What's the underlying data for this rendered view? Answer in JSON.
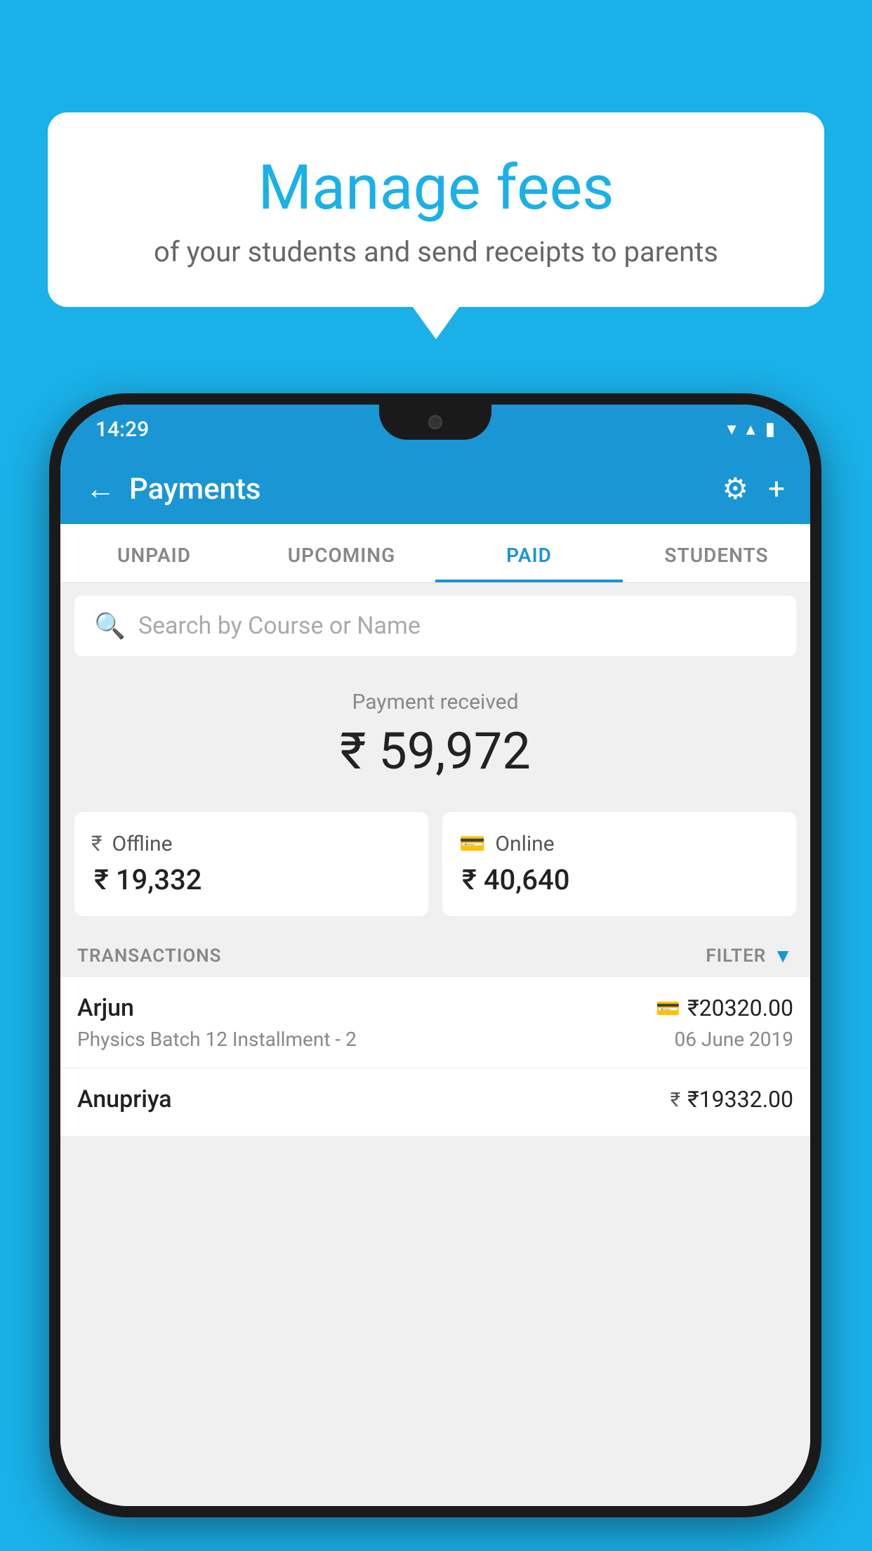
{
  "page": {
    "bg_color": "#1ab0e8"
  },
  "speech_bubble": {
    "title": "Manage fees",
    "subtitle": "of your students and send receipts to parents"
  },
  "status_bar": {
    "time": "14:29",
    "wifi_icon": "▼",
    "signal_icon": "▲",
    "battery_icon": "▮"
  },
  "app_bar": {
    "title": "Payments",
    "back_label": "←",
    "settings_label": "⚙",
    "add_label": "+"
  },
  "tabs": [
    {
      "label": "UNPAID",
      "active": false
    },
    {
      "label": "UPCOMING",
      "active": false
    },
    {
      "label": "PAID",
      "active": true
    },
    {
      "label": "STUDENTS",
      "active": false
    }
  ],
  "search": {
    "placeholder": "Search by Course or Name"
  },
  "payment_summary": {
    "label": "Payment received",
    "total": "₹ 59,972",
    "offline_label": "Offline",
    "offline_amount": "₹ 19,332",
    "online_label": "Online",
    "online_amount": "₹ 40,640"
  },
  "transactions_section": {
    "label": "TRANSACTIONS",
    "filter_label": "FILTER"
  },
  "transactions": [
    {
      "name": "Arjun",
      "course": "Physics Batch 12 Installment - 2",
      "amount": "₹20320.00",
      "date": "06 June 2019",
      "payment_type": "card"
    },
    {
      "name": "Anupriya",
      "course": "",
      "amount": "₹19332.00",
      "date": "",
      "payment_type": "cash"
    }
  ]
}
